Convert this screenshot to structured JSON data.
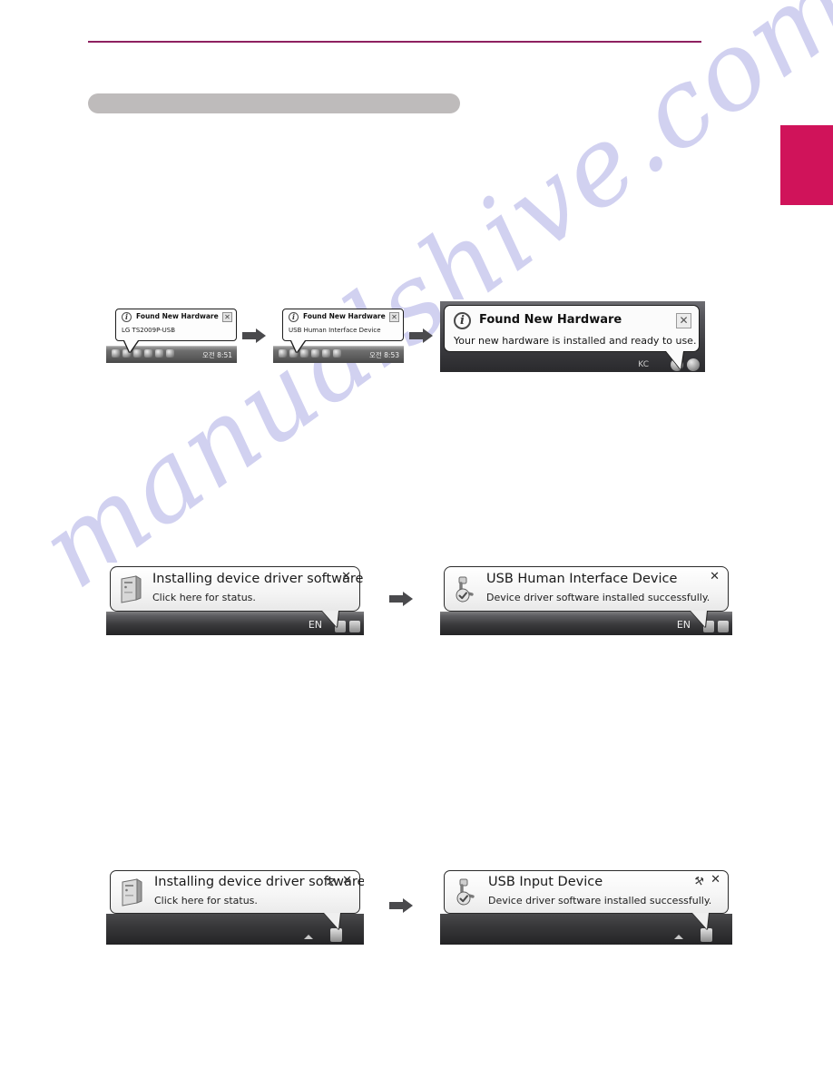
{
  "page": {
    "accent_color": "#8e2060",
    "tab_color": "#d0135a",
    "heading_placeholder_color": "#bebbbb",
    "watermark": "manualshive.com"
  },
  "figures": [
    {
      "id": "windows-xp-sequence",
      "os": "Windows XP",
      "steps": [
        {
          "style": "xp",
          "icon": "info-icon",
          "icon_glyph": "i",
          "title": "Found New Hardware",
          "body": "LG TS2009P-USB",
          "close_label": "✕",
          "taskbar": {
            "clock": "오전 8:51",
            "tray_icon_count": 6
          }
        },
        {
          "style": "xp",
          "icon": "info-icon",
          "icon_glyph": "i",
          "title": "Found New Hardware",
          "body": "USB Human Interface Device",
          "close_label": "✕",
          "taskbar": {
            "clock": "오전 8:53",
            "tray_icon_count": 6
          }
        },
        {
          "style": "xp-large",
          "icon": "info-icon",
          "icon_glyph": "i",
          "title": "Found New Hardware",
          "body": "Your new hardware is installed and ready to use.",
          "close_label": "✕",
          "taskbar": {
            "label": "KC",
            "tray_icon_count": 2
          }
        }
      ]
    },
    {
      "id": "windows-vista-sequence",
      "os": "Windows Vista",
      "steps": [
        {
          "style": "vista",
          "icon": "computer-tower-icon",
          "title": "Installing device driver software",
          "body": "Click here for status.",
          "close_label": "✕",
          "taskbar": {
            "lang": "EN",
            "tray_icon_count": 2
          }
        },
        {
          "style": "vista",
          "icon": "usb-device-check-icon",
          "title": "USB Human Interface Device",
          "body": "Device driver software installed successfully.",
          "close_label": "✕",
          "taskbar": {
            "lang": "EN",
            "tray_icon_count": 2
          }
        }
      ]
    },
    {
      "id": "windows-7-sequence",
      "os": "Windows 7",
      "steps": [
        {
          "style": "win7",
          "icon": "computer-tower-icon",
          "title": "Installing device driver software",
          "body": "Click here for status.",
          "wrench_label": "⚒",
          "close_label": "✕",
          "taskbar": {
            "chevron": true,
            "tray_icon_count": 1
          }
        },
        {
          "style": "win7",
          "icon": "usb-device-check-icon",
          "title": "USB Input Device",
          "body": "Device driver software installed successfully.",
          "wrench_label": "⚒",
          "close_label": "✕",
          "taskbar": {
            "chevron": true,
            "tray_icon_count": 1
          }
        }
      ]
    }
  ]
}
